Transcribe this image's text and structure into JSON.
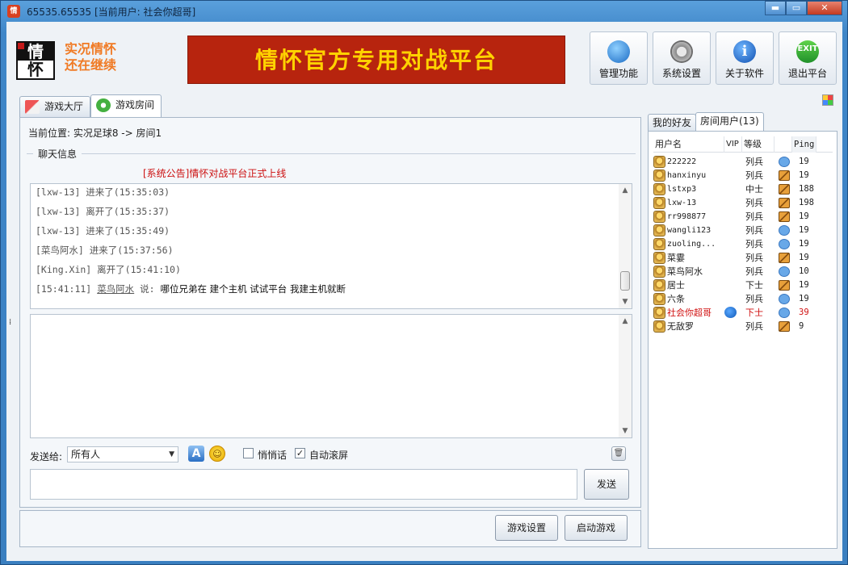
{
  "window": {
    "title": "65535.65535 [当前用户: 社会你超哥]",
    "controls": {
      "minimize": "▬",
      "maximize": "▭",
      "close": "✕"
    }
  },
  "logo": {
    "char1": "情",
    "char2": "怀"
  },
  "slogan": {
    "line1": "实况情怀",
    "line2": "还在继续"
  },
  "banner": "情怀官方专用对战平台",
  "toolbar": [
    {
      "id": "manage",
      "label": "管理功能",
      "icon": "manage-icon"
    },
    {
      "id": "settings",
      "label": "系统设置",
      "icon": "gear-icon"
    },
    {
      "id": "about",
      "label": "关于软件",
      "icon": "info-icon",
      "glyph": "i"
    },
    {
      "id": "exit",
      "label": "退出平台",
      "icon": "exit-icon",
      "glyph": "EXIT"
    }
  ],
  "tabs": [
    {
      "label": "游戏大厅",
      "icon": "house-icon",
      "active": false
    },
    {
      "label": "游戏房间",
      "icon": "gamepad-icon",
      "active": true
    }
  ],
  "location": "当前位置: 实况足球8 -> 房间1",
  "chat": {
    "legend": "聊天信息",
    "announcement": "[系统公告]情怀对战平台正式上线",
    "lines": [
      "[lxw-13] 进来了(15:35:03)",
      "[lxw-13] 离开了(15:35:37)",
      "[lxw-13] 进来了(15:35:49)",
      "[菜鸟阿水] 进来了(15:37:56)",
      "[King.Xin] 离开了(15:41:10)"
    ],
    "last_line": {
      "time": "[15:41:11]",
      "sender": "菜鸟阿水",
      "says": "说:",
      "message": "哪位兄弟在 建个主机 试试平台  我建主机就断"
    }
  },
  "send_to": {
    "label": "发送给:",
    "value": "所有人"
  },
  "toolbar_icons": {
    "font": "A",
    "smile": "☺",
    "clear": "🗑"
  },
  "checkboxes": [
    {
      "label": "悄悄话",
      "checked": false
    },
    {
      "label": "自动滚屏",
      "checked": true
    }
  ],
  "send_button": "发送",
  "bottom_buttons": {
    "game_settings": "游戏设置",
    "start_game": "启动游戏"
  },
  "right_tabs": [
    {
      "label": "我的好友",
      "active": false
    },
    {
      "label": "房间用户(13)",
      "active": true
    }
  ],
  "users_header": {
    "name": "用户名",
    "vip": "VIP",
    "rank": "等级",
    "ping": "Ping"
  },
  "users": [
    {
      "name": "222222",
      "rank": "列兵",
      "status": "chat",
      "ping": "19",
      "vip": false,
      "me": false
    },
    {
      "name": "hanxinyu",
      "rank": "列兵",
      "status": "game",
      "ping": "19",
      "vip": false,
      "me": false
    },
    {
      "name": "lstxp3",
      "rank": "中士",
      "status": "game",
      "ping": "188",
      "vip": false,
      "me": false
    },
    {
      "name": "lxw-13",
      "rank": "列兵",
      "status": "game",
      "ping": "198",
      "vip": false,
      "me": false
    },
    {
      "name": "rr998877",
      "rank": "列兵",
      "status": "game",
      "ping": "19",
      "vip": false,
      "me": false
    },
    {
      "name": "wangli123",
      "rank": "列兵",
      "status": "chat",
      "ping": "19",
      "vip": false,
      "me": false
    },
    {
      "name": "zuoling...",
      "rank": "列兵",
      "status": "chat",
      "ping": "19",
      "vip": false,
      "me": false
    },
    {
      "name": "菜霎",
      "rank": "列兵",
      "status": "game",
      "ping": "19",
      "vip": false,
      "me": false
    },
    {
      "name": "菜鸟阿水",
      "rank": "列兵",
      "status": "chat",
      "ping": "10",
      "vip": false,
      "me": false
    },
    {
      "name": "居士",
      "rank": "下士",
      "status": "game",
      "ping": "19",
      "vip": false,
      "me": false
    },
    {
      "name": "六条",
      "rank": "列兵",
      "status": "chat",
      "ping": "19",
      "vip": false,
      "me": false
    },
    {
      "name": "社会你超哥",
      "rank": "下士",
      "status": "chat",
      "ping": "39",
      "vip": true,
      "me": true
    },
    {
      "name": "无敌罗",
      "rank": "列兵",
      "status": "game",
      "ping": "9",
      "vip": false,
      "me": false
    }
  ]
}
